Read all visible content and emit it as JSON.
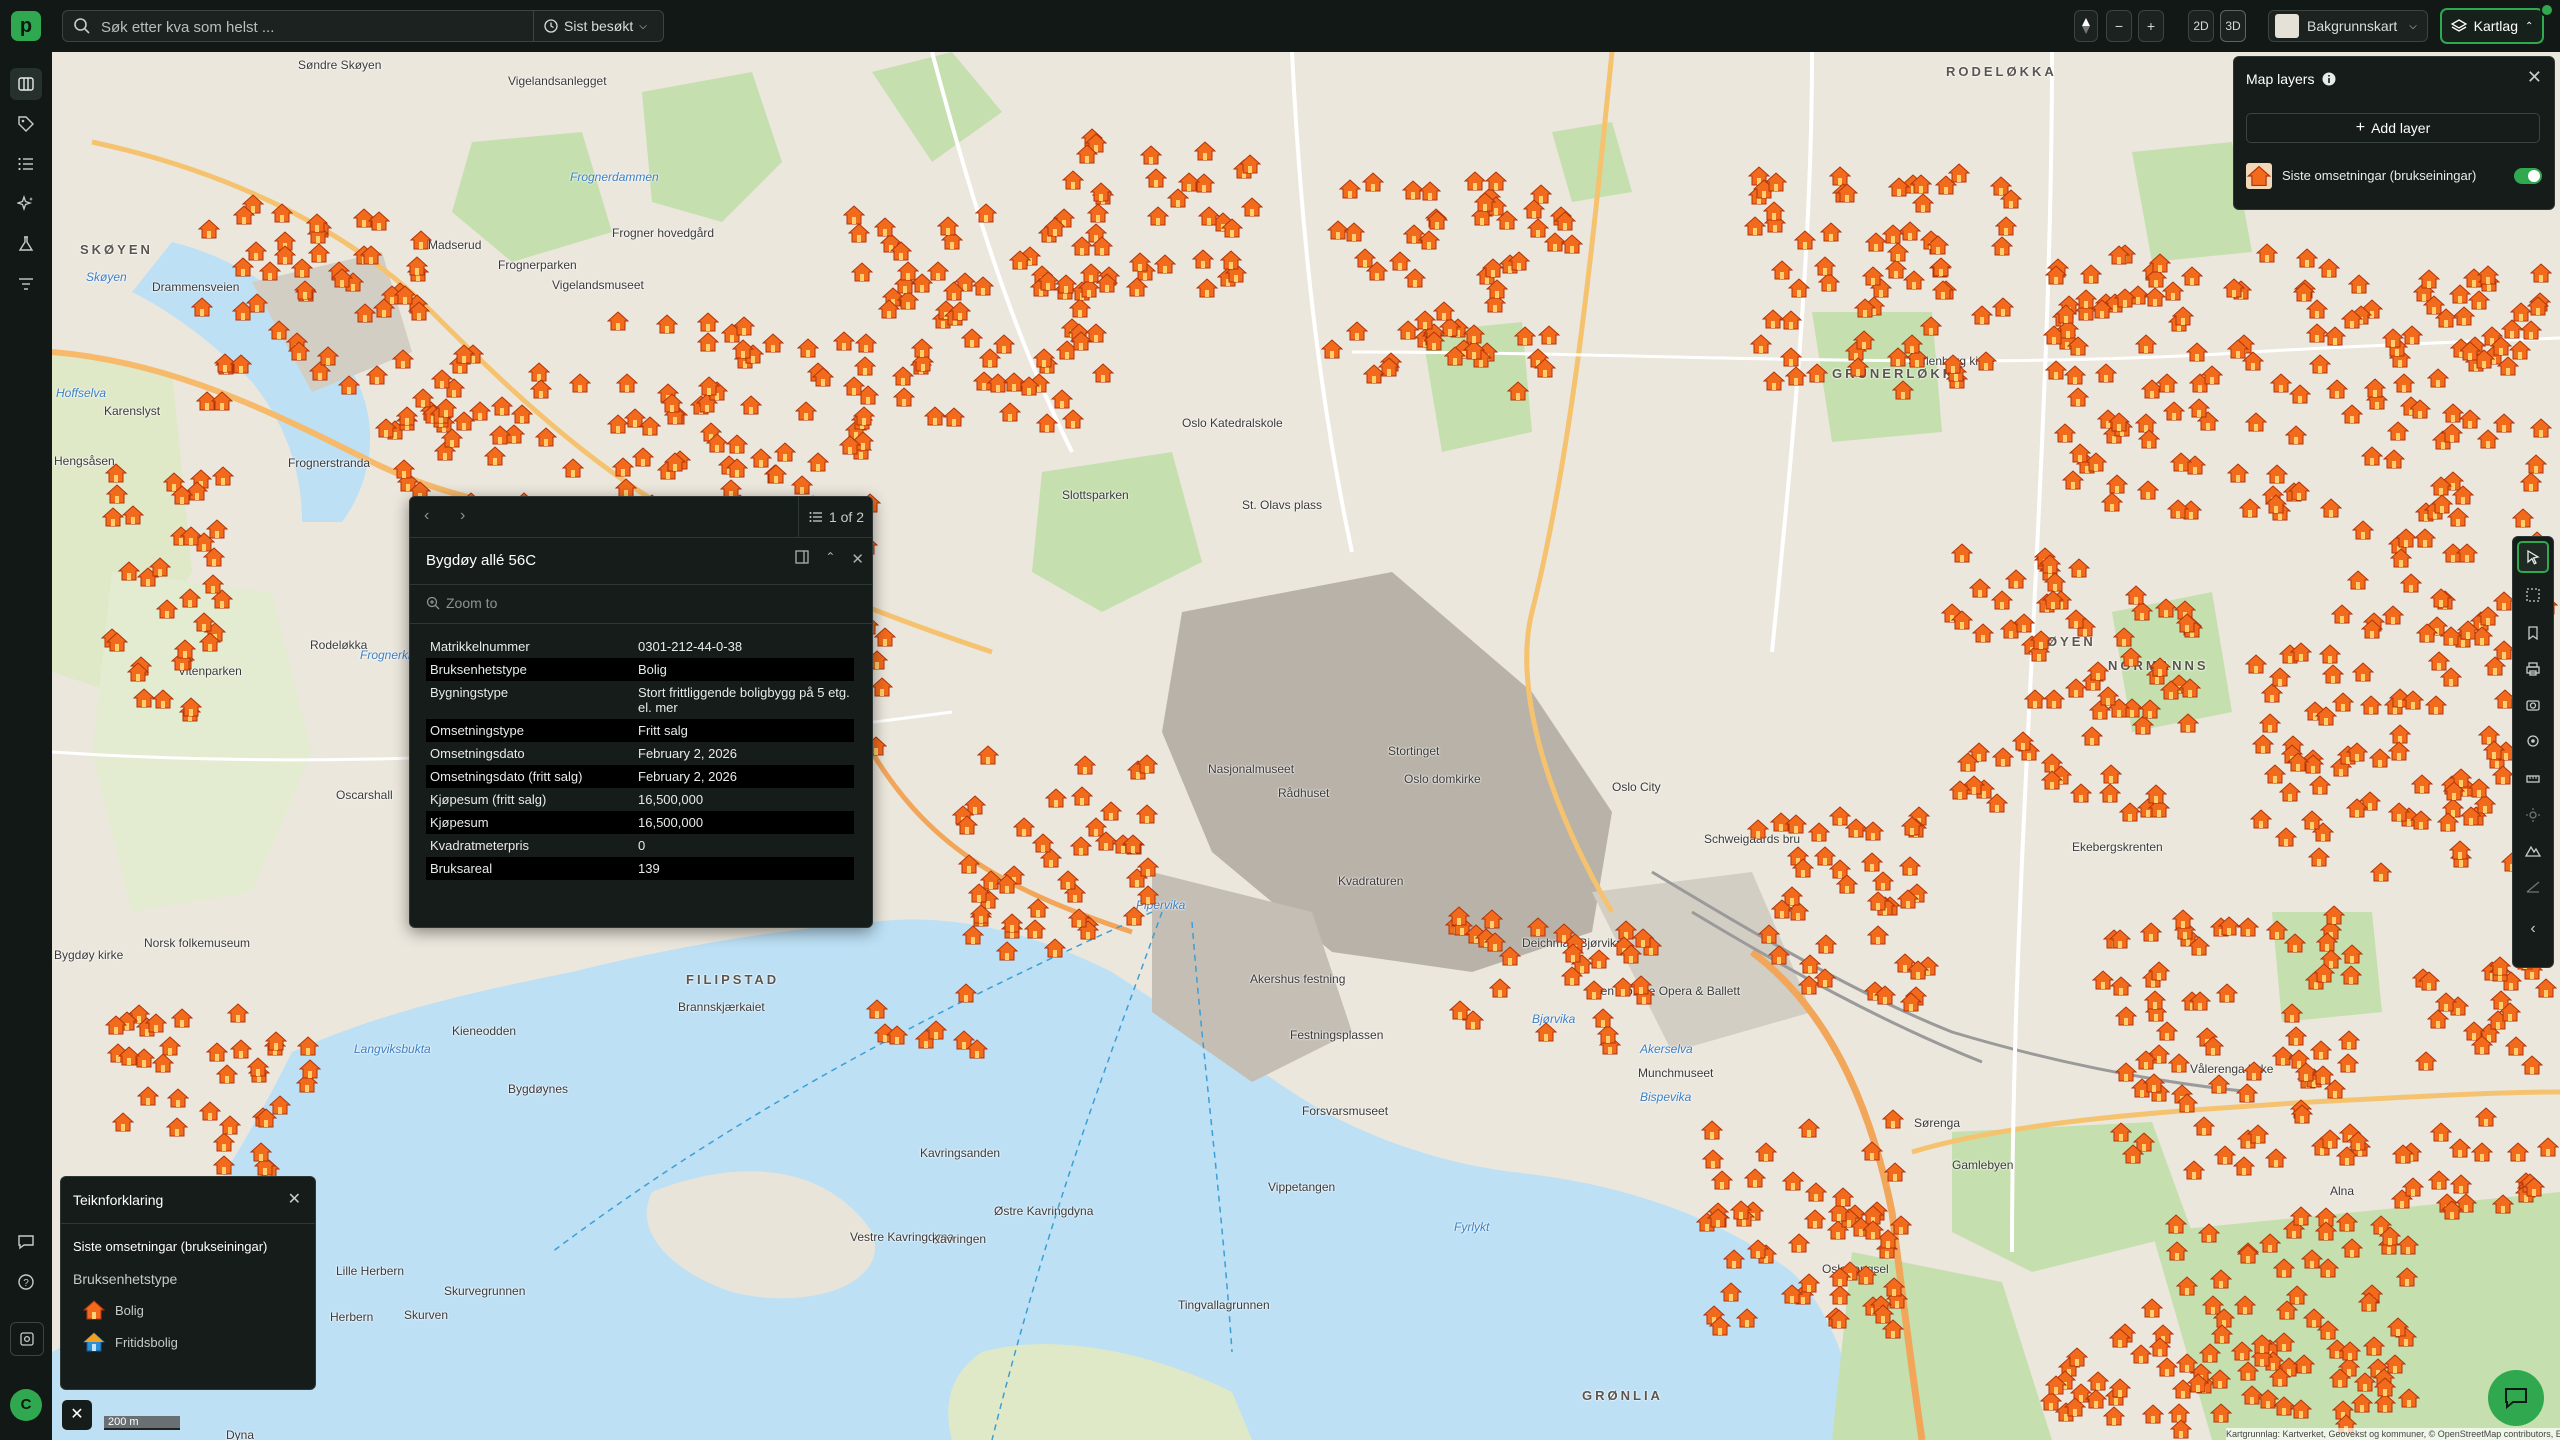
{
  "app": {
    "logo_letter": "p",
    "search_placeholder": "Søk etter kva som helst ...",
    "recent_label": "Sist besøkt",
    "view_2d": "2D",
    "view_3d": "3D",
    "basemap_label": "Bakgrunnskart",
    "layers_label": "Kartlag",
    "avatar_initial": "C",
    "accent_color": "#2fa84f"
  },
  "map_labels": [
    "Søndre Skøyen",
    "Vigelandsanlegget",
    "Frognerdammen",
    "Frognerparken",
    "Frogner hovedgård",
    "Madserud",
    "Vigelandsmuseet",
    "SKØYEN",
    "Skøyen",
    "Drammensveien",
    "Hoffselva",
    "Karenslyst",
    "Hengsåsen",
    "Frognerstranda",
    "Rodeløkka",
    "Oscarshall",
    "Norsk folkemuseum",
    "Bygdøy kirke",
    "Vitenparken",
    "Frognerkilen",
    "Langviksbukta",
    "Kieneodden",
    "Bygdøynes",
    "Lille Herbern",
    "Skurvegrunnen",
    "Herbern",
    "Skurven",
    "Dyna",
    "FILIPSTAD",
    "Brannskjærkaiet",
    "Kavringsanden",
    "Østre Kavringdyna",
    "Vestre Kavringdyna",
    "Kavringen",
    "Tingvallagrunnen",
    "Pipervika",
    "Akershus festning",
    "Festningsplassen",
    "Forsvarsmuseet",
    "Vippetangen",
    "Munchmuseet",
    "Bispevika",
    "Bjørvika",
    "Akerselva",
    "Deichman Bjørvika",
    "Den Norske Opera & Ballett",
    "Oslo domkirke",
    "Oslo City",
    "Schweigaards bru",
    "St. Olavs plass",
    "Oslo Katedralskole",
    "Sofienberg kirke",
    "GRÜNERLØKKA",
    "RODELØKKA",
    "TØYEN",
    "NORMANNS",
    "GRØNLIA",
    "Gamlebyen",
    "Ekebergskrenten",
    "Vålerenga kirke",
    "Alna",
    "Sørenga",
    "Nasjonalmuseet",
    "Rådhuset",
    "Stortinget",
    "Slottsparken",
    "Kvadraturen",
    "Fyrlykt",
    "Oslo fengsel"
  ],
  "popup": {
    "page_counter": "1 of 2",
    "title": "Bygdøy allé 56C",
    "zoom_to": "Zoom to",
    "rows": [
      {
        "key": "Matrikkelnummer",
        "value": "0301-212-44-0-38"
      },
      {
        "key": "Bruksenhetstype",
        "value": "Bolig"
      },
      {
        "key": "Bygningstype",
        "value": "Stort frittliggende boligbygg på 5 etg. el. mer"
      },
      {
        "key": "Omsetningstype",
        "value": "Fritt salg"
      },
      {
        "key": "Omsetningsdato",
        "value": "February 2, 2026"
      },
      {
        "key": "Omsetningsdato (fritt salg)",
        "value": "February 2, 2026"
      },
      {
        "key": "Kjøpesum (fritt salg)",
        "value": "16,500,000"
      },
      {
        "key": "Kjøpesum",
        "value": "16,500,000"
      },
      {
        "key": "Kvadratmeterpris",
        "value": "0"
      },
      {
        "key": "Bruksareal",
        "value": "139"
      }
    ]
  },
  "legend": {
    "title": "Teiknforklaring",
    "layer_name": "Siste omsetningar (brukseiningar)",
    "field_name": "Bruksenhetstype",
    "items": [
      {
        "label": "Bolig",
        "color": "#f26b1d"
      },
      {
        "label": "Fritidsbolig",
        "color": "#2a8fd8"
      }
    ]
  },
  "map_layers": {
    "title": "Map layers",
    "add_label": "Add layer",
    "layer_name": "Siste omsetningar (brukseiningar)",
    "layer_visible": true
  },
  "scale": {
    "label": "200 m"
  },
  "attribution": "Kartgrunnlag: Kartverket, Geovekst og kommuner, © OpenStreetMap contributors, Esri | Powered by Esri"
}
